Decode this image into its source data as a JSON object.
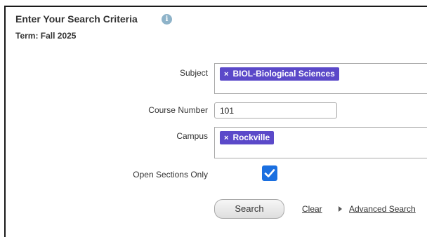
{
  "header": {
    "title": "Enter Your Search Criteria",
    "info_icon": "info-icon",
    "term": "Term: Fall 2025"
  },
  "form": {
    "subject": {
      "label": "Subject",
      "chips": [
        "BIOL-Biological Sciences"
      ]
    },
    "course_number": {
      "label": "Course Number",
      "value": "101"
    },
    "campus": {
      "label": "Campus",
      "chips": [
        "Rockville"
      ]
    },
    "open_sections": {
      "label": "Open Sections Only",
      "checked": true
    }
  },
  "actions": {
    "search_label": "Search",
    "clear_label": "Clear",
    "advanced_label": "Advanced Search"
  },
  "colors": {
    "chip": "#5b49c9",
    "checkbox": "#1a6fe0",
    "info_icon": "#8eb3c9"
  },
  "chip_remove_glyph": "×"
}
